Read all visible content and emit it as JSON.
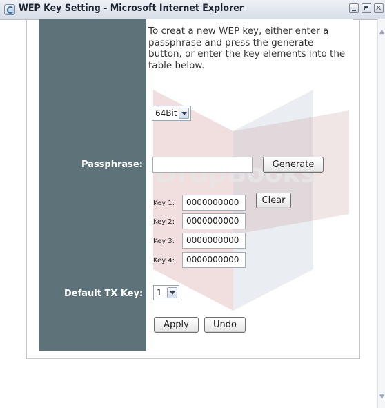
{
  "window": {
    "title": "WEP Key Setting - Microsoft Internet Explorer"
  },
  "instructions": "To creat a new WEP key, either enter a passphrase and press the generate button, or enter the key elements into the table below.",
  "encryption": {
    "selected": "64Bit"
  },
  "passphrase": {
    "label": "Passphrase:",
    "value": "",
    "generate_label": "Generate"
  },
  "keys": [
    {
      "label": "Key 1:",
      "value": "0000000000"
    },
    {
      "label": "Key 2:",
      "value": "0000000000"
    },
    {
      "label": "Key 3:",
      "value": "0000000000"
    },
    {
      "label": "Key 4:",
      "value": "0000000000"
    }
  ],
  "clear_label": "Clear",
  "default_tx": {
    "label": "Default TX Key:",
    "selected": "1"
  },
  "actions": {
    "apply_label": "Apply",
    "undo_label": "Undo"
  },
  "icons": {
    "app": "ie-window-icon",
    "minimize": "minimize-icon",
    "maximize": "maximize-icon",
    "close": "close-icon",
    "dropdown": "chevron-down-icon"
  },
  "colors": {
    "left_panel": "#5e7379",
    "title_text": "#1d2430",
    "label_text": "#ffffff"
  },
  "watermark": {
    "text": "DropBooks"
  }
}
